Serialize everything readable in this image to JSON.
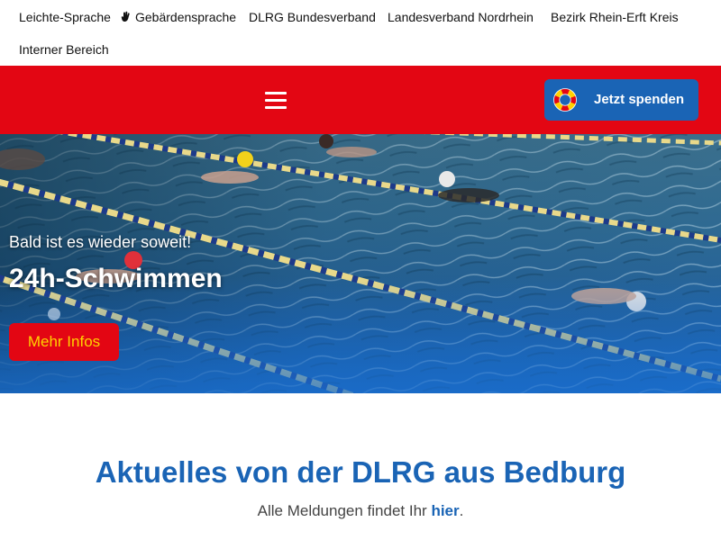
{
  "topnav": {
    "items": [
      {
        "label": "Leichte-Sprache"
      },
      {
        "label": "Gebärdensprache",
        "icon": "sign-language-hand-icon"
      },
      {
        "label": "DLRG Bundesverband"
      },
      {
        "label": "Landesverband Nordrhein"
      },
      {
        "label": "Bezirk Rhein-Erft Kreis"
      },
      {
        "label": "Interner Bereich"
      }
    ]
  },
  "header": {
    "menu_icon": "hamburger-menu-icon",
    "donate": {
      "label": "Jetzt spenden",
      "icon": "lifebuoy-icon"
    }
  },
  "hero": {
    "eyebrow": "Bald ist es wieder soweit!",
    "title": "24h-Schwimmen",
    "cta_label": "Mehr Infos"
  },
  "news": {
    "title": "Aktuelles von der DLRG aus Bedburg",
    "subtitle_prefix": "Alle Meldungen findet Ihr",
    "subtitle_link": "hier",
    "subtitle_suffix": "."
  },
  "colors": {
    "brand_red": "#e30613",
    "brand_blue": "#1a64b5",
    "cta_text_yellow": "#ffd200",
    "white": "#ffffff"
  }
}
